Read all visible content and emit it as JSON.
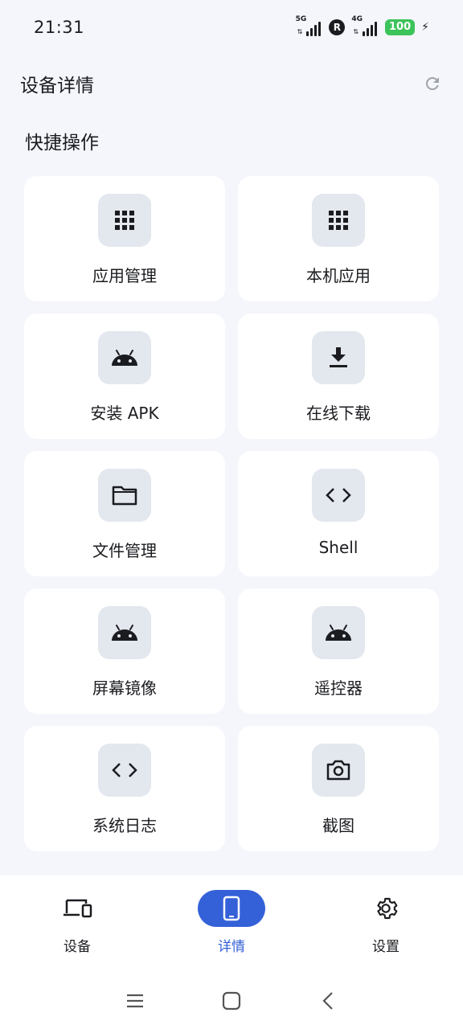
{
  "status_bar": {
    "time": "21:31",
    "net1": "5G",
    "net2": "4G",
    "roaming": "R",
    "battery": "100"
  },
  "header": {
    "title": "设备详情",
    "refresh_icon": "refresh-icon"
  },
  "section_title": "快捷操作",
  "actions": [
    {
      "label": "应用管理",
      "icon": "apps-grid-icon"
    },
    {
      "label": "本机应用",
      "icon": "apps-grid-icon"
    },
    {
      "label": "安装 APK",
      "icon": "android-icon"
    },
    {
      "label": "在线下载",
      "icon": "download-icon"
    },
    {
      "label": "文件管理",
      "icon": "folder-icon"
    },
    {
      "label": "Shell",
      "icon": "code-icon"
    },
    {
      "label": "屏幕镜像",
      "icon": "android-icon"
    },
    {
      "label": "遥控器",
      "icon": "android-icon"
    },
    {
      "label": "系统日志",
      "icon": "code-icon"
    },
    {
      "label": "截图",
      "icon": "camera-icon"
    }
  ],
  "bottom_nav": {
    "items": [
      {
        "label": "设备",
        "icon": "devices-icon",
        "active": false
      },
      {
        "label": "详情",
        "icon": "phone-icon",
        "active": true
      },
      {
        "label": "设置",
        "icon": "gear-icon",
        "active": false
      }
    ]
  },
  "colors": {
    "accent": "#3461d8",
    "background": "#f4f6fb",
    "card": "#ffffff",
    "icon_tile": "#e3e7ee",
    "battery": "#3cc35a"
  }
}
